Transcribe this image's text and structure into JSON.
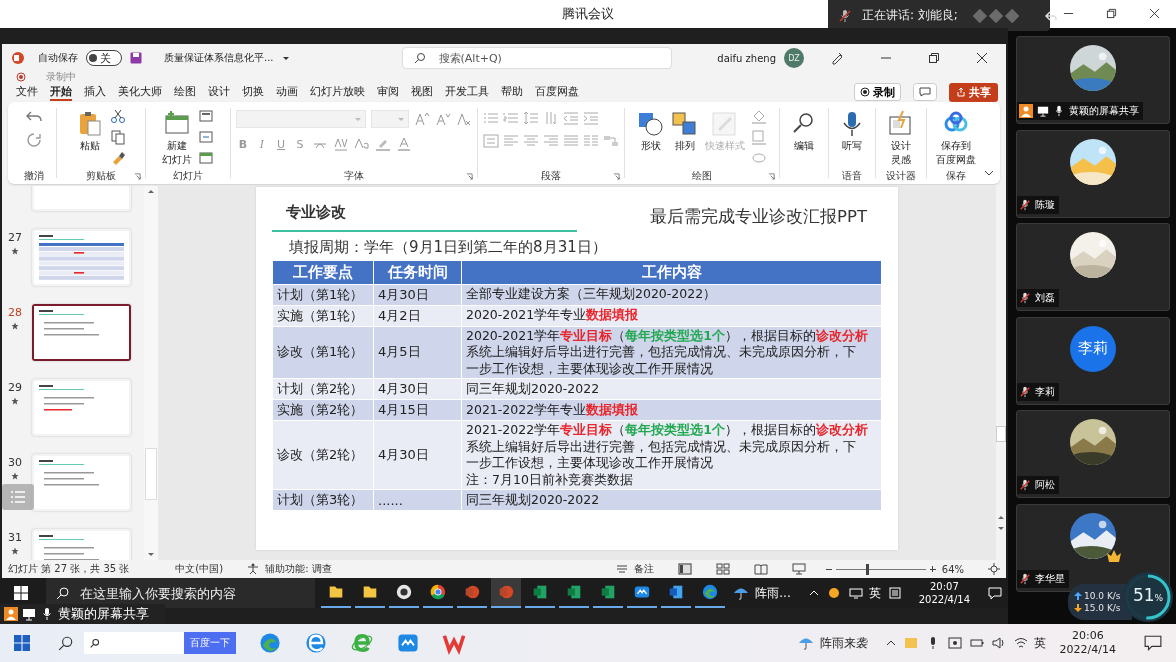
{
  "meeting_title": "腾讯会议",
  "speaking": {
    "label": "正在讲话: 刘能良;"
  },
  "ppt": {
    "autosave": {
      "label": "自动保存",
      "on": false,
      "state_text": "关"
    },
    "file_name": "质量保证体系信息化平...",
    "search": {
      "placeholder": "搜索(Alt+Q)"
    },
    "user": {
      "name": "daifu zheng",
      "initials": "DZ"
    },
    "recording_label": "录制中",
    "tabs": [
      {
        "label": "文件",
        "selected": false
      },
      {
        "label": "开始",
        "selected": true
      },
      {
        "label": "插入",
        "selected": false
      },
      {
        "label": "美化大师",
        "selected": false
      },
      {
        "label": "绘图",
        "selected": false
      },
      {
        "label": "设计",
        "selected": false
      },
      {
        "label": "切换",
        "selected": false
      },
      {
        "label": "动画",
        "selected": false
      },
      {
        "label": "幻灯片放映",
        "selected": false
      },
      {
        "label": "审阅",
        "selected": false
      },
      {
        "label": "视图",
        "selected": false
      },
      {
        "label": "开发工具",
        "selected": false
      },
      {
        "label": "帮助",
        "selected": false
      },
      {
        "label": "百度网盘",
        "selected": false
      }
    ],
    "record_button": "录制",
    "share_button": "共享",
    "ribbon": [
      {
        "kind": "undo",
        "label": "撤消"
      },
      {
        "kind": "clipboard",
        "label": "剪贴板",
        "buttons": [
          {
            "label": "粘贴",
            "disabled": false
          }
        ]
      },
      {
        "kind": "slides",
        "label": "幻灯片",
        "buttons": [
          {
            "lines": [
              "新建",
              "幻灯片"
            ],
            "disabled": false
          }
        ]
      },
      {
        "kind": "font",
        "label": "字体",
        "format_buttons": [
          "B",
          "I",
          "U",
          "S"
        ]
      },
      {
        "kind": "paragraph",
        "label": "段落"
      },
      {
        "kind": "drawing",
        "label": "绘图",
        "buttons": [
          {
            "label": "形状",
            "disabled": false
          },
          {
            "label": "排列",
            "disabled": false
          },
          {
            "label": "快速样式",
            "disabled": true
          }
        ]
      },
      {
        "kind": "editing",
        "buttons": [
          {
            "label": "编辑",
            "disabled": false
          }
        ]
      },
      {
        "kind": "voice",
        "label": "语音",
        "buttons": [
          {
            "label": "听写",
            "disabled": false
          }
        ]
      },
      {
        "kind": "designer",
        "label": "设计器",
        "buttons": [
          {
            "lines": [
              "设计",
              "灵感"
            ],
            "disabled": false
          }
        ]
      },
      {
        "kind": "save",
        "label": "保存",
        "buttons": [
          {
            "lines": [
              "保存到",
              "百度网盘"
            ],
            "disabled": false
          }
        ]
      }
    ],
    "thumbnails": [
      {
        "kind": "text",
        "selected": false
      },
      {
        "number": "27",
        "kind": "table",
        "selected": false
      },
      {
        "number": "28",
        "kind": "text",
        "selected": true
      },
      {
        "number": "29",
        "kind": "text",
        "selected": false
      },
      {
        "number": "30",
        "kind": "text",
        "selected": false
      },
      {
        "number": "31",
        "kind": "text",
        "selected": false
      }
    ],
    "slide": {
      "title": "专业诊改",
      "headline": "最后需完成专业诊改汇报PPT",
      "period": "填报周期：学年（9月1日到第二年的8月31日）",
      "table": {
        "columns": [
          "工作要点",
          "任务时间",
          "工作内容"
        ],
        "rows": [
          {
            "cells": [
              "计划（第1轮）",
              "4月30日"
            ],
            "content": [
              [
                {
                  "text": "全部专业建设方案（三年规划2020-2022）"
                }
              ]
            ]
          },
          {
            "cells": [
              "实施（第1轮）",
              "4月2日"
            ],
            "content": [
              [
                {
                  "text": "2020-2021学年专业"
                },
                {
                  "text": "数据填报",
                  "color": "#e8262b"
                }
              ]
            ]
          },
          {
            "cells": [
              "诊改（第1轮）",
              "4月5日"
            ],
            "content": [
              [
                {
                  "text": "2020-2021学年"
                },
                {
                  "text": "专业目标",
                  "color": "#e8262b"
                },
                {
                  "text": "（"
                },
                {
                  "text": "每年按类型选1个",
                  "color": "#1fa84f"
                },
                {
                  "text": "），根据目标的"
                },
                {
                  "text": "诊改分析",
                  "color": "#e8262b"
                }
              ],
              [
                {
                  "text": "系统上编辑好后导出进行完善，包括完成情况、未完成原因分析，下"
                }
              ],
              [
                {
                  "text": "一步工作设想，主要体现诊改工作开展情况"
                }
              ]
            ]
          },
          {
            "cells": [
              "计划（第2轮）",
              "4月30日"
            ],
            "content": [
              [
                {
                  "text": "同三年规划2020-2022"
                }
              ]
            ]
          },
          {
            "cells": [
              "实施（第2轮）",
              "4月15日"
            ],
            "content": [
              [
                {
                  "text": "2021-2022学年专业"
                },
                {
                  "text": "数据填报",
                  "color": "#e8262b"
                }
              ]
            ]
          },
          {
            "cells": [
              "诊改（第2轮）",
              "4月30日"
            ],
            "content": [
              [
                {
                  "text": "2021-2022学年"
                },
                {
                  "text": "专业目标",
                  "color": "#e8262b"
                },
                {
                  "text": "（"
                },
                {
                  "text": "每年按类型选1个",
                  "color": "#1fa84f"
                },
                {
                  "text": "），根据目标的"
                },
                {
                  "text": "诊改分析",
                  "color": "#e8262b"
                }
              ],
              [
                {
                  "text": "系统上编辑好后导出进行完善，包括完成情况、未完成原因分析，下"
                }
              ],
              [
                {
                  "text": "一步工作设想，主要体现诊改工作开展情况"
                }
              ],
              [
                {
                  "text": "注：7月10日前补竞赛类数据"
                }
              ]
            ]
          },
          {
            "cells": [
              "计划（第3轮）",
              "......"
            ],
            "content": [
              [
                {
                  "text": "同三年规划2020-2022"
                }
              ]
            ]
          }
        ]
      }
    },
    "status_bar": {
      "slide_info": "幻灯片 第 27 张，共 35 张",
      "language": "中文(中国)",
      "accessibility": "辅助功能: 调查",
      "notes": "备注",
      "zoom": {
        "reading": "64%",
        "level": 0.35
      }
    }
  },
  "shared_taskbar": {
    "search_placeholder": "在这里输入你要搜索的内容",
    "weather": "阵雨...",
    "ime": "英",
    "time": "20:07",
    "date": "2022/4/14"
  },
  "share_label": "黄颖的屏幕共享",
  "participants": [
    {
      "name": "黄颖的屏幕共享",
      "sharing": true,
      "muted": false,
      "vip": false
    },
    {
      "name": "陈璇",
      "sharing": false,
      "muted": true,
      "vip": false
    },
    {
      "name": "刘磊",
      "sharing": false,
      "muted": true,
      "vip": false
    },
    {
      "name": "李莉",
      "avatar": {
        "kind": "initials",
        "text": "李莉"
      },
      "sharing": false,
      "muted": true,
      "vip": false
    },
    {
      "name": "阿松",
      "sharing": false,
      "muted": true,
      "vip": false
    },
    {
      "name": "李华星",
      "sharing": false,
      "muted": true,
      "vip": true
    }
  ],
  "network": {
    "upload": "10.0 K/s",
    "download": "15.0 K/s",
    "cpu_value": "51",
    "cpu_unit": "%",
    "level": 0.51
  },
  "taskbar": {
    "search_button": "百度一下",
    "weather": "阵雨来袭",
    "ime": "英",
    "time": "20:06",
    "date": "2022/4/14"
  }
}
